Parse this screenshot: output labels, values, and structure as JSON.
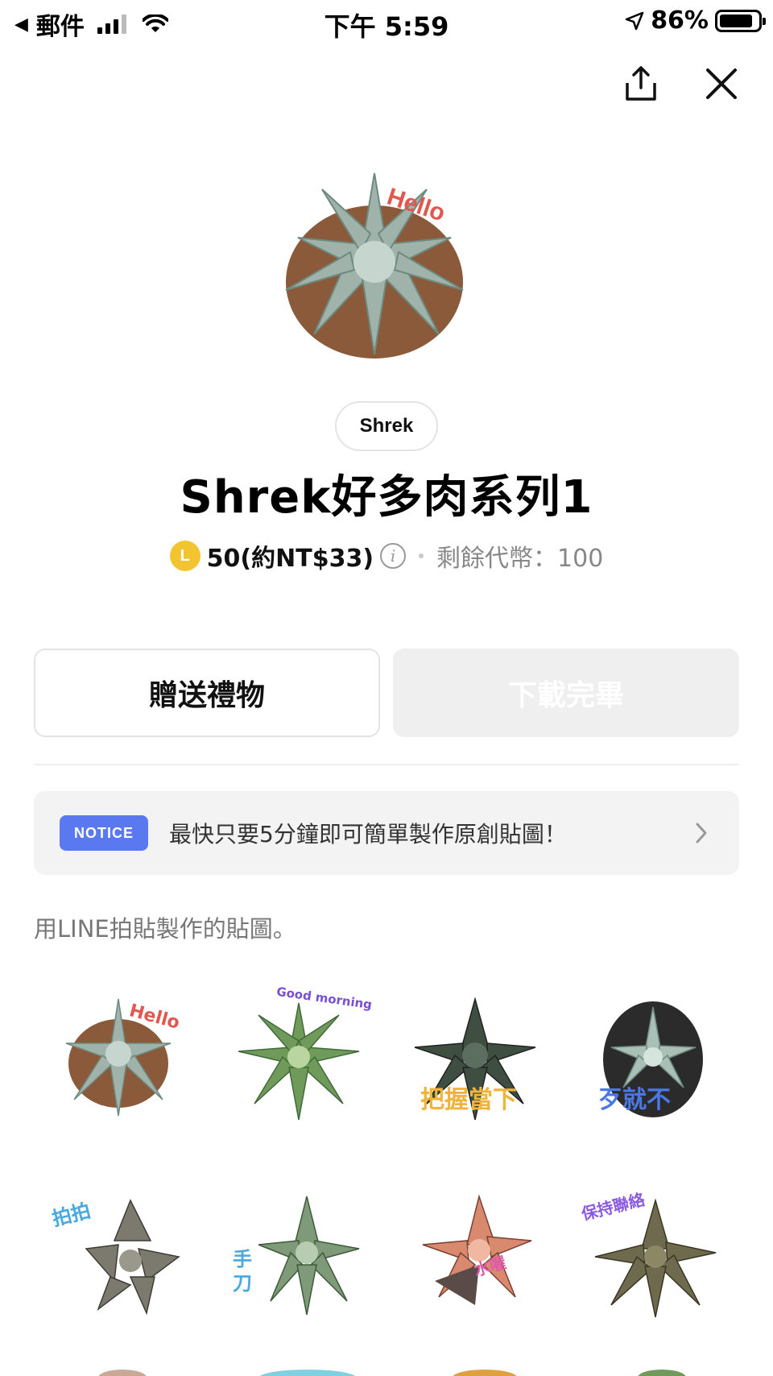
{
  "status_bar": {
    "back_app": "郵件",
    "time": "下午 5:59",
    "battery": "86%",
    "battery_level": 0.86
  },
  "top_actions": {
    "share_icon": "share-icon",
    "close_icon": "close-icon"
  },
  "hero": {
    "caption": "Hello"
  },
  "author": "Shrek",
  "title": "Shrek好多肉系列1",
  "price": {
    "coin_letter": "L",
    "amount": "50(約NT$33)",
    "remaining": "剩餘代幣：100"
  },
  "buttons": {
    "gift": "贈送禮物",
    "download": "下載完畢"
  },
  "notice": {
    "badge": "NOTICE",
    "text": "最快只要5分鐘即可簡單製作原創貼圖！"
  },
  "description": "用LINE拍貼製作的貼圖。",
  "stickers": [
    {
      "caption": "Hello",
      "color": "#e0584f"
    },
    {
      "caption": "Good morning",
      "color": "#7a4fd6"
    },
    {
      "caption": "把握當下",
      "color": "#f0b43a"
    },
    {
      "caption": "歹就不",
      "color": "#4a78e6"
    },
    {
      "caption": "拍拍",
      "color": "#4aa8e0"
    },
    {
      "caption": "手刀",
      "color": "#4aa8e0"
    },
    {
      "caption": "水喔",
      "color": "#e05aa8"
    },
    {
      "caption": "保持聯絡",
      "color": "#8a5ae0"
    }
  ],
  "colors": {
    "accent": "#5a78f0",
    "coin": "#f2c530"
  }
}
